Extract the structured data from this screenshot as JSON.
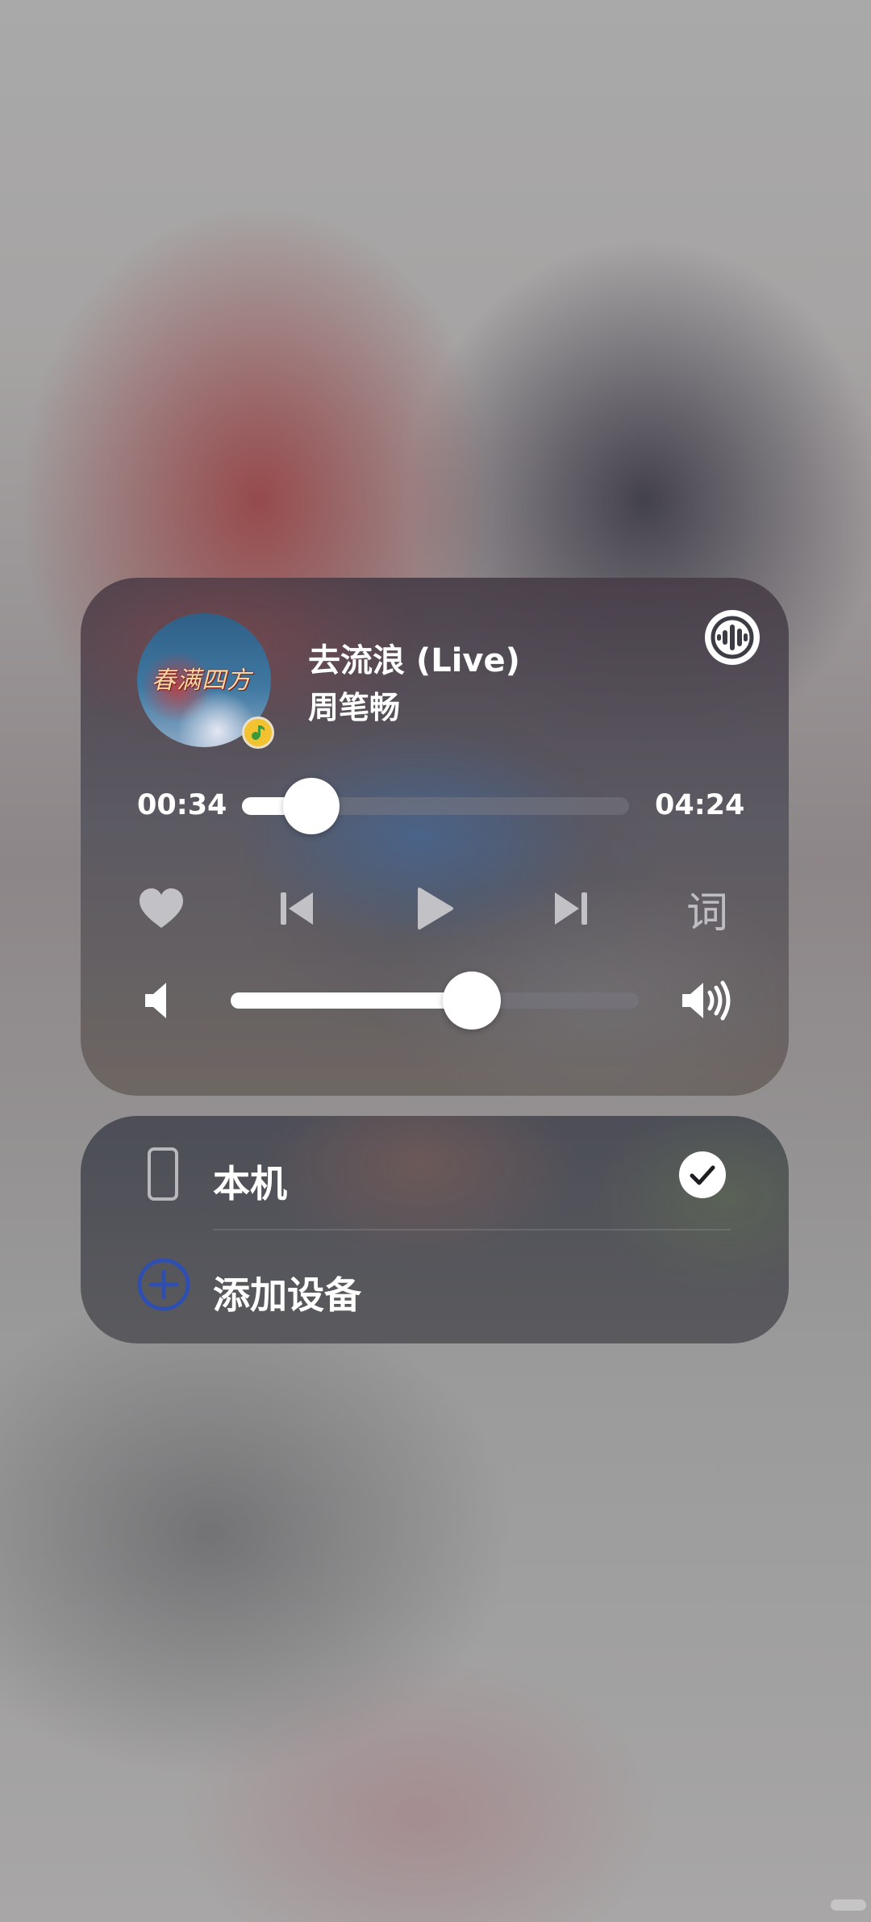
{
  "player": {
    "song_title": "去流浪 (Live)",
    "artist": "周笔畅",
    "album_art_text": "春满四方",
    "current_time": "00:34",
    "total_time": "04:24",
    "progress": 0.134,
    "volume": 0.59,
    "lyrics_label": "词",
    "icons": {
      "audio_output": "sound-wave-icon",
      "like": "heart-icon",
      "previous": "skip-previous-icon",
      "play": "play-icon",
      "next": "skip-next-icon",
      "volume_low": "volume-low-icon",
      "volume_high": "volume-high-icon"
    }
  },
  "devices": {
    "local_label": "本机",
    "add_label": "添加设备",
    "local_selected": true,
    "icons": {
      "local": "phone-icon",
      "selected": "check-icon",
      "add": "plus-circle-icon"
    }
  },
  "colors": {
    "accent_blue": "#2f4fb0",
    "text": "#ffffff",
    "muted_icon": "#bdbdc2"
  }
}
